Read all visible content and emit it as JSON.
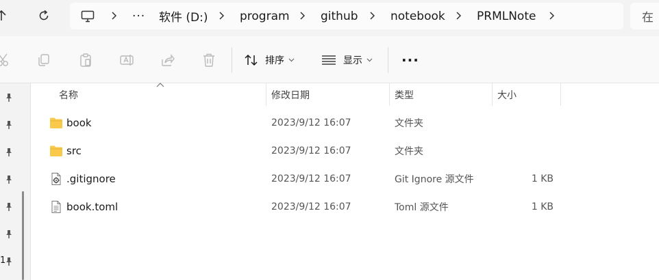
{
  "breadcrumb": {
    "overflow": "···",
    "segments": [
      "软件 (D:)",
      "program",
      "github",
      "notebook",
      "PRMLNote"
    ]
  },
  "search": {
    "placeholder": "在"
  },
  "toolbar": {
    "sort_label": "排序",
    "view_label": "显示",
    "more_label": "···"
  },
  "columns": {
    "name": "名称",
    "date": "修改日期",
    "type": "类型",
    "size": "大小"
  },
  "files": [
    {
      "icon": "folder-icon",
      "name": "book",
      "date": "2023/9/12 16:07",
      "type": "文件夹",
      "size": ""
    },
    {
      "icon": "folder-icon",
      "name": "src",
      "date": "2023/9/12 16:07",
      "type": "文件夹",
      "size": ""
    },
    {
      "icon": "config-file-icon",
      "name": ".gitignore",
      "date": "2023/9/12 16:07",
      "type": "Git Ignore 源文件",
      "size": "1 KB"
    },
    {
      "icon": "text-file-icon",
      "name": "book.toml",
      "date": "2023/9/12 16:07",
      "type": "Toml 源文件",
      "size": "1 KB"
    }
  ],
  "leftnav": {
    "stray_text": "1"
  },
  "colors": {
    "folder": "#f8c94a",
    "folder_dark": "#e9b537",
    "icon_disabled": "#b9b9b9",
    "text": "#1a1a1a",
    "meta_text": "#555555"
  }
}
